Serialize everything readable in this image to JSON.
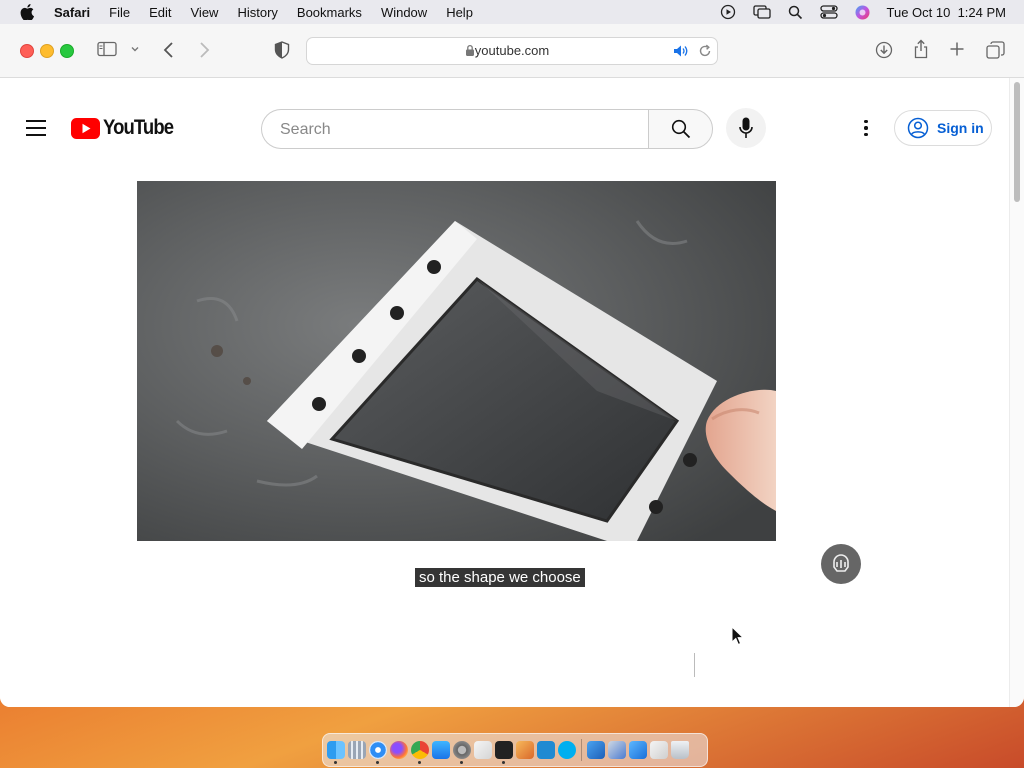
{
  "menubar": {
    "app_name": "Safari",
    "items": [
      "File",
      "Edit",
      "View",
      "History",
      "Bookmarks",
      "Window",
      "Help"
    ],
    "datetime": "Tue Oct 10  1:24 PM"
  },
  "browser": {
    "url": "youtube.com"
  },
  "youtube": {
    "logo_text": "YouTube",
    "search_placeholder": "Search",
    "signin_label": "Sign in",
    "caption": "so the shape we choose"
  },
  "colors": {
    "youtube_red": "#ff0000",
    "signin_blue": "#065fd4"
  },
  "dock": {
    "icons": [
      "finder-icon",
      "launchpad-icon",
      "safari-icon",
      "firefox-icon",
      "chrome-icon",
      "app-store-icon",
      "system-settings-icon",
      "textedit-icon",
      "terminal-icon",
      "instruments-icon",
      "vscode-icon",
      "skype-icon",
      "downloads-stack-icon",
      "screenshots-stack-icon",
      "xcode-icon",
      "documents-stack-icon",
      "trash-icon"
    ]
  }
}
